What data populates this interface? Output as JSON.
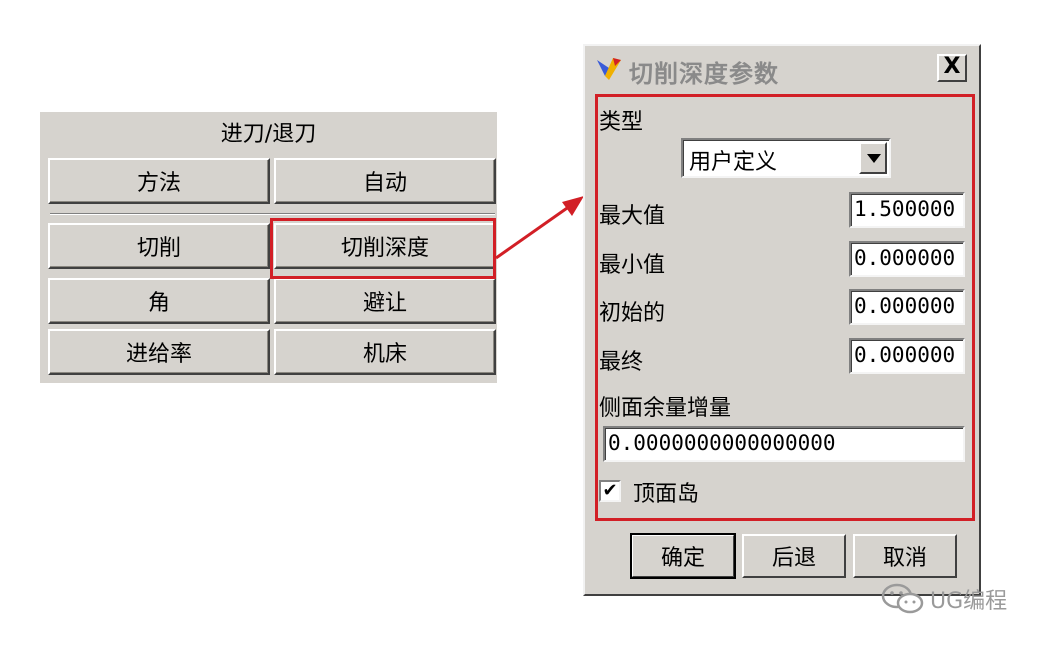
{
  "left_panel": {
    "title": "进刀/退刀",
    "buttons": {
      "method": "方法",
      "auto": "自动",
      "cut": "切削",
      "cut_depth": "切削深度",
      "angle": "角",
      "avoid": "避让",
      "feed_rate": "进给率",
      "machine": "机床"
    }
  },
  "dialog": {
    "title": "切削深度参数",
    "close_label": "X",
    "type_label": "类型",
    "type_value": "用户定义",
    "max_label": "最大值",
    "max_value": "1.500000",
    "min_label": "最小值",
    "min_value": "0.000000",
    "initial_label": "初始的",
    "initial_value": "0.000000",
    "final_label": "最终",
    "final_value": "0.000000",
    "side_stock_label": "侧面余量增量",
    "side_stock_value": "0.0000000000000000",
    "top_island_label": "顶面岛",
    "top_island_checked": true,
    "check_mark": "✔",
    "ok_label": "确定",
    "back_label": "后退",
    "cancel_label": "取消"
  },
  "watermark": {
    "text": "UG编程"
  },
  "colors": {
    "panel_bg": "#d6d3ce",
    "highlight": "#d21f26"
  }
}
